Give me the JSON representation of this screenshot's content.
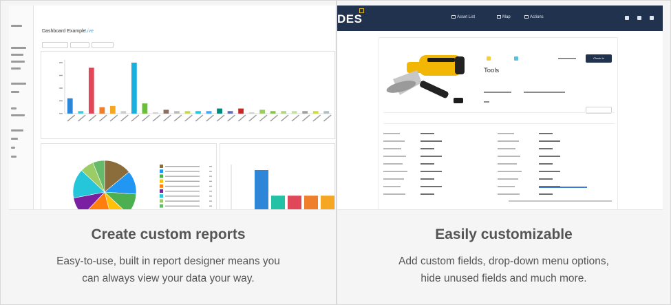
{
  "left_panel": {
    "heading": "Create custom reports",
    "description_line1": "Easy-to-use, built in report designer means you",
    "description_line2": "can always view your data your way.",
    "dashboard": {
      "title": "Dashboard Example",
      "subtitle_link": "Live",
      "bar_chart": {
        "type": "bar",
        "bars": [
          {
            "value": 6,
            "color": "#2e86d9"
          },
          {
            "value": 1,
            "color": "#4cc9d8"
          },
          {
            "value": 18,
            "color": "#e0485a"
          },
          {
            "value": 2.5,
            "color": "#f07f2b"
          },
          {
            "value": 3,
            "color": "#f5a623"
          },
          {
            "value": 1,
            "color": "#cfcfcf"
          },
          {
            "value": 20,
            "color": "#19b0e0"
          },
          {
            "value": 4,
            "color": "#6abf3a"
          },
          {
            "value": 0.5,
            "color": "#cfcfcf"
          },
          {
            "value": 1.5,
            "color": "#8d6e63"
          },
          {
            "value": 1,
            "color": "#bdbdbd"
          },
          {
            "value": 1,
            "color": "#c7d94d"
          },
          {
            "value": 1,
            "color": "#26c6da"
          },
          {
            "value": 1,
            "color": "#42a5f5"
          },
          {
            "value": 2,
            "color": "#00897b"
          },
          {
            "value": 1,
            "color": "#5c6bc0"
          },
          {
            "value": 2,
            "color": "#c62828"
          },
          {
            "value": 0.5,
            "color": "#cfcfcf"
          },
          {
            "value": 1.5,
            "color": "#9ccc65"
          },
          {
            "value": 1,
            "color": "#8bc34a"
          },
          {
            "value": 1,
            "color": "#aed581"
          },
          {
            "value": 1,
            "color": "#c5e1a5"
          },
          {
            "value": 1,
            "color": "#9e9e9e"
          },
          {
            "value": 1,
            "color": "#cddc39"
          },
          {
            "value": 1,
            "color": "#b0bec5"
          }
        ]
      },
      "pie_chart": {
        "type": "pie",
        "slices": [
          {
            "value": 14,
            "color": "#8a6d3b"
          },
          {
            "value": 12,
            "color": "#2196f3"
          },
          {
            "value": 11,
            "color": "#4caf50"
          },
          {
            "value": 9,
            "color": "#ffc107"
          },
          {
            "value": 16,
            "color": "#ff7f0e"
          },
          {
            "value": 10,
            "color": "#7b1fa2"
          },
          {
            "value": 15,
            "color": "#26c6da"
          },
          {
            "value": 7,
            "color": "#9ccc65"
          },
          {
            "value": 6,
            "color": "#66bb6a"
          }
        ]
      },
      "bar_chart_2": {
        "type": "bar",
        "bars": [
          {
            "value": 10,
            "color": "#2e86d9"
          },
          {
            "value": 4,
            "color": "#21c2a5"
          },
          {
            "value": 4,
            "color": "#e0485a"
          },
          {
            "value": 4,
            "color": "#f07f2b"
          },
          {
            "value": 4,
            "color": "#f5a623"
          }
        ]
      }
    }
  },
  "right_panel": {
    "heading": "Easily customizable",
    "description_line1": "Add custom fields, drop-down menu options,",
    "description_line2": "hide unused fields and much more.",
    "app": {
      "logo": "DES",
      "nav": [
        "Asset List",
        "Map",
        "Actions"
      ],
      "product_title": "Tools",
      "primary_button": "Check In",
      "colors": {
        "navbar": "#20324d",
        "tag_yellow": "#f4d03f",
        "tag_teal": "#5bc0de",
        "logo_accent": "#d5b22a"
      }
    }
  }
}
